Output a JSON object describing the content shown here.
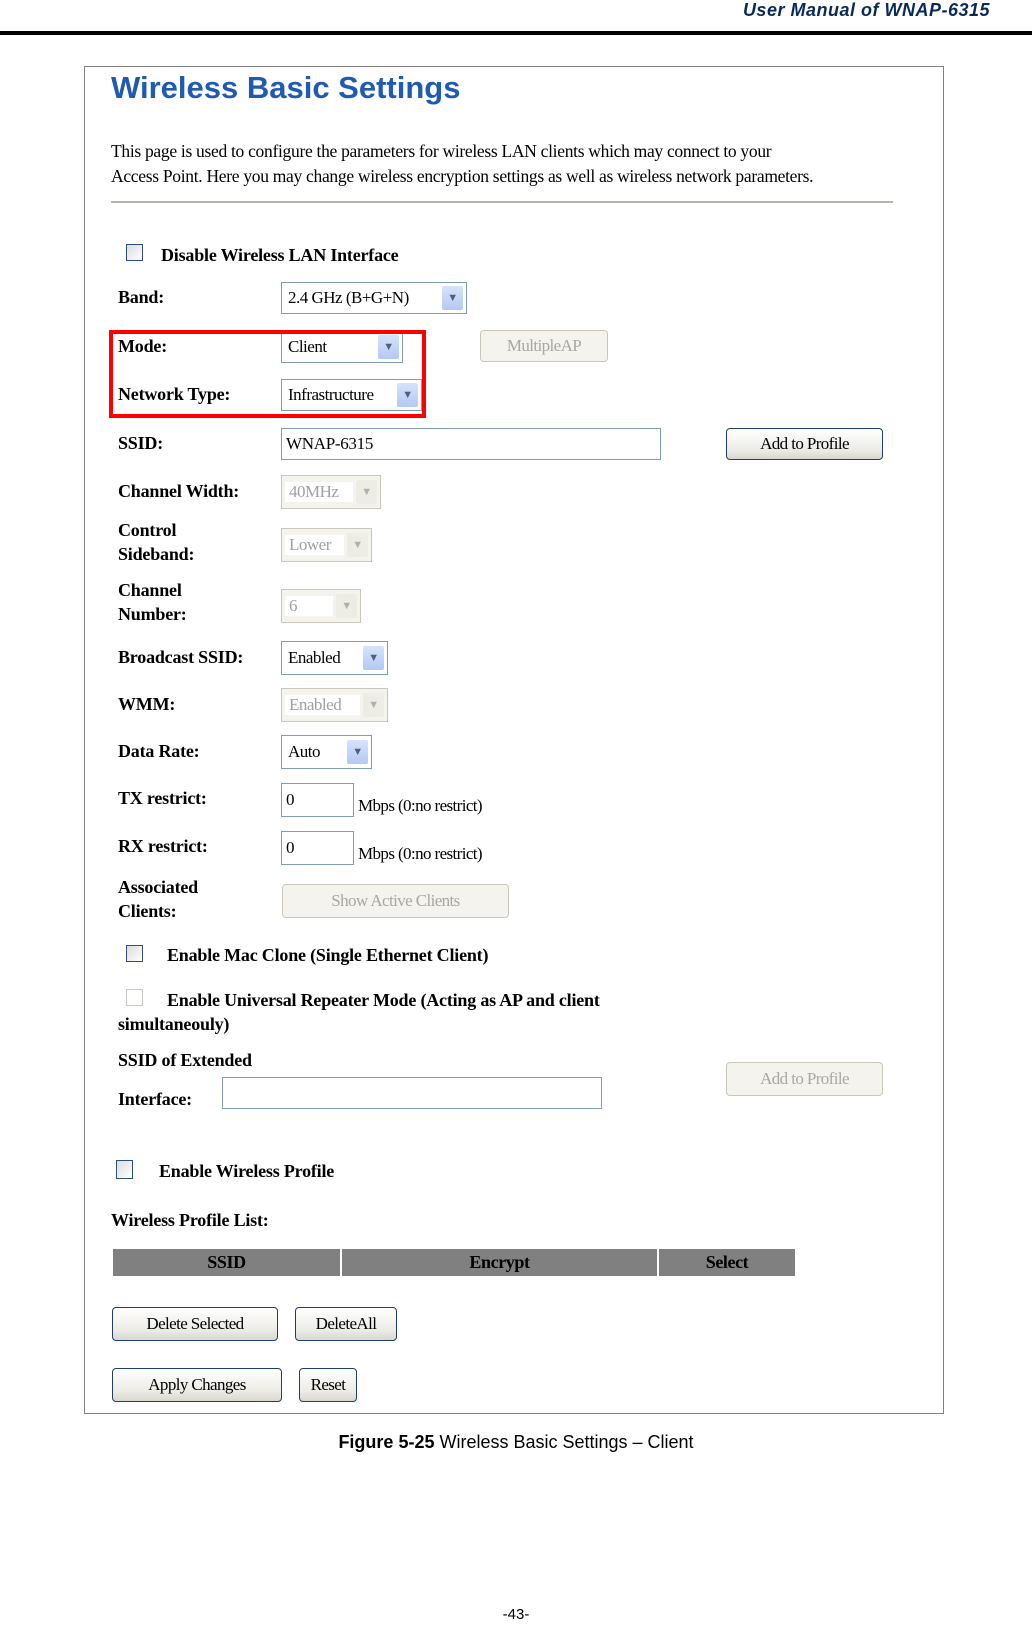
{
  "header": {
    "title": "User  Manual  of  WNAP-6315"
  },
  "page": {
    "title": "Wireless Basic Settings",
    "description_line1": "This page is used to configure the parameters for wireless LAN clients which may connect to your",
    "description_line2": "Access Point. Here you may change wireless encryption settings as well as wireless network parameters."
  },
  "form": {
    "disable_wlan": {
      "label": "Disable Wireless LAN Interface",
      "checked": false
    },
    "band": {
      "label": "Band:",
      "value": "2.4 GHz (B+G+N)"
    },
    "mode": {
      "label": "Mode:",
      "value": "Client"
    },
    "multiple_ap_button": "MultipleAP",
    "network_type": {
      "label": "Network Type:",
      "value": "Infrastructure"
    },
    "ssid": {
      "label": "SSID:",
      "value": "WNAP-6315"
    },
    "add_to_profile_button": "Add to Profile",
    "channel_width": {
      "label": "Channel Width:",
      "value": "40MHz"
    },
    "control_sideband": {
      "label_line1": "Control",
      "label_line2": "Sideband:",
      "value": "Lower"
    },
    "channel_number": {
      "label_line1": "Channel",
      "label_line2": "Number:",
      "value": "6"
    },
    "broadcast_ssid": {
      "label": "Broadcast SSID:",
      "value": "Enabled"
    },
    "wmm": {
      "label": "WMM:",
      "value": "Enabled"
    },
    "data_rate": {
      "label": "Data Rate:",
      "value": "Auto"
    },
    "tx_restrict": {
      "label": "TX restrict:",
      "value": "0",
      "unit": "Mbps (0:no restrict)"
    },
    "rx_restrict": {
      "label": "RX restrict:",
      "value": "0",
      "unit": "Mbps (0:no restrict)"
    },
    "associated_clients": {
      "label_line1": "Associated",
      "label_line2": "Clients:",
      "button": "Show Active Clients"
    },
    "mac_clone": {
      "label": "Enable Mac Clone (Single Ethernet Client)",
      "checked": false
    },
    "universal_repeater": {
      "label_line1": "Enable Universal Repeater Mode (Acting as AP and client",
      "label_line2": "simultaneouly)",
      "checked": false
    },
    "extended_ssid": {
      "label_line1": "SSID of Extended",
      "label_line2": "Interface:",
      "value": "",
      "button": "Add to Profile"
    },
    "wireless_profile": {
      "label": "Enable Wireless Profile",
      "checked": false
    },
    "profile_list": {
      "title": "Wireless Profile List:",
      "columns": [
        "SSID",
        "Encrypt",
        "Select"
      ],
      "rows": []
    },
    "delete_selected_button": "Delete Selected",
    "delete_all_button": "DeleteAll",
    "apply_button": "Apply Changes",
    "reset_button": "Reset"
  },
  "caption": {
    "bold": "Figure 5-25",
    "text": " Wireless Basic Settings – Client"
  },
  "footer": {
    "page_number": "-43-"
  },
  "colors": {
    "title_blue": "#1f5bb0",
    "highlight_red": "#ff0000",
    "table_header": "#808080"
  }
}
